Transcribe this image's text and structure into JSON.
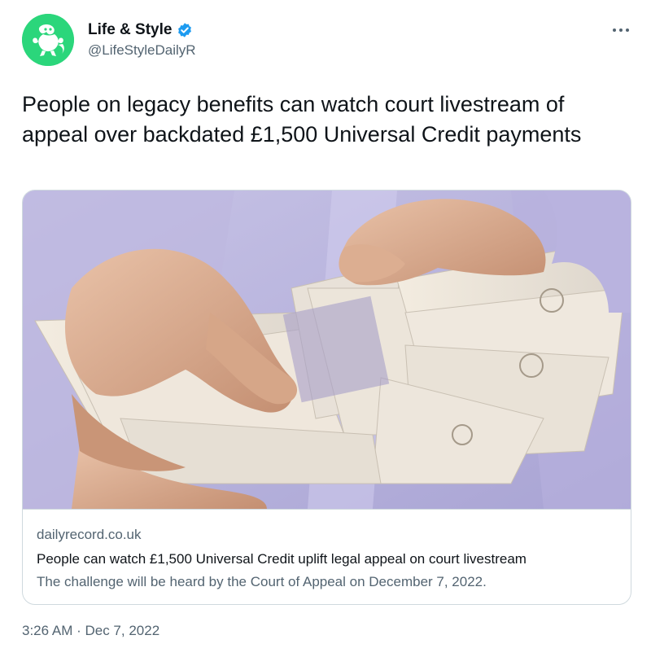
{
  "account": {
    "display_name": "Life & Style",
    "handle": "@LifeStyleDailyR",
    "verified": true,
    "avatar_color": "#2bd67b"
  },
  "tweet": {
    "text": "People on legacy benefits can watch court livestream of appeal over backdated £1,500 Universal Credit payments",
    "timestamp": "3:26 AM · Dec 7, 2022"
  },
  "card": {
    "domain": "dailyrecord.co.uk",
    "title": "People can watch £1,500 Universal Credit uplift legal appeal on court livestream",
    "description": "The challenge will be heard by the Court of Appeal on December 7, 2022."
  },
  "icons": {
    "verified": "verified-badge-icon",
    "more": "more-options-icon"
  },
  "colors": {
    "verified_blue": "#1d9bf0",
    "secondary_text": "#536471",
    "border": "#cfd9de"
  }
}
